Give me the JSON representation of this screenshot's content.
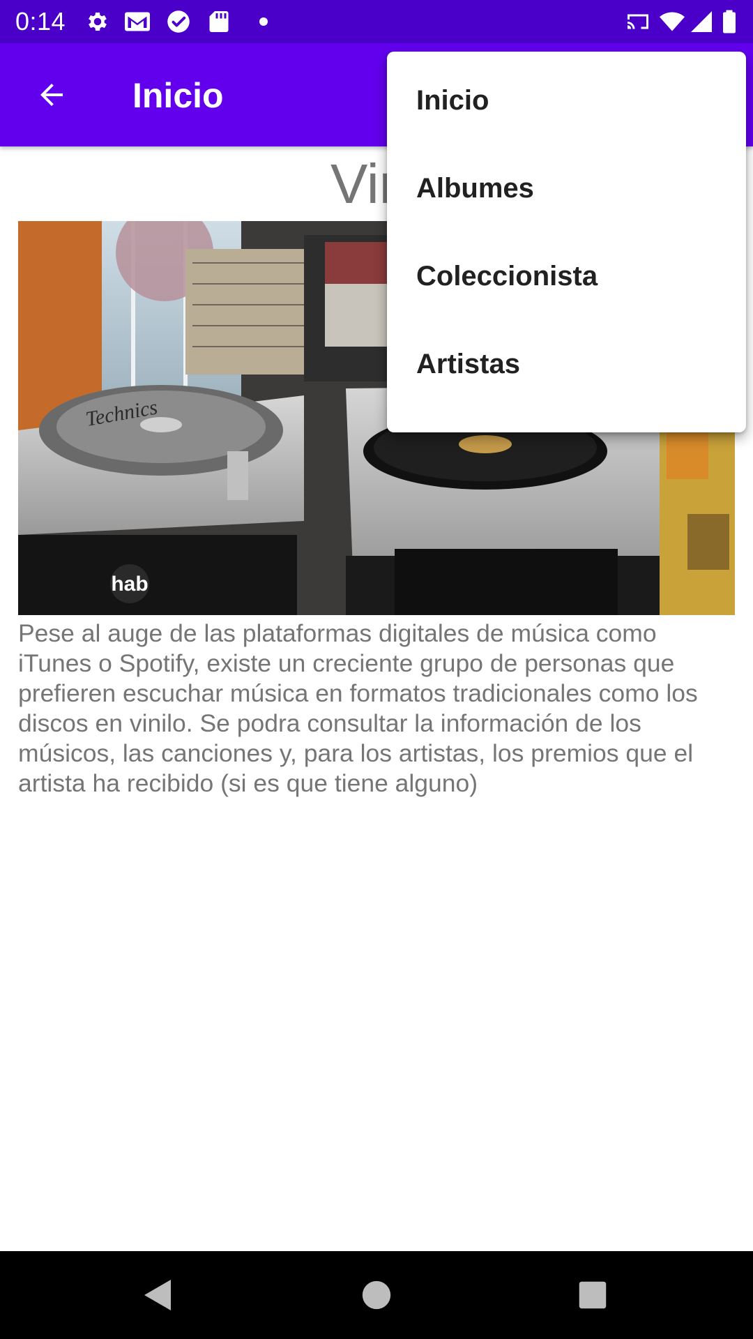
{
  "status_bar": {
    "time": "0:14",
    "left_icons": [
      "gear-icon",
      "gmail-icon",
      "check-circle-icon",
      "sd-card-icon",
      "dot-icon"
    ],
    "right_icons": [
      "cast-icon",
      "wifi-icon",
      "signal-icon",
      "battery-icon"
    ]
  },
  "toolbar": {
    "back_icon": "arrow-back-icon",
    "title": "Inicio",
    "color": "#6200ee",
    "status_color": "#4a00c8"
  },
  "main": {
    "heading": "Vini",
    "image_caption": "hab",
    "image_brand": "Technics",
    "description": "Pese al auge de las plataformas digitales de música como iTunes o Spotify, existe un creciente grupo de personas que prefieren escuchar música en formatos tradicionales como los discos en vinilo.  Se podra consultar la información de los músicos, las canciones y, para los artistas, los premios que el artista ha recibido (si es que tiene alguno)"
  },
  "menu": {
    "items": [
      {
        "label": "Inicio"
      },
      {
        "label": "Albumes"
      },
      {
        "label": "Coleccionista"
      },
      {
        "label": "Artistas"
      }
    ]
  },
  "nav_bar": {
    "buttons": [
      "back-triangle-icon",
      "home-circle-icon",
      "recents-square-icon"
    ]
  }
}
